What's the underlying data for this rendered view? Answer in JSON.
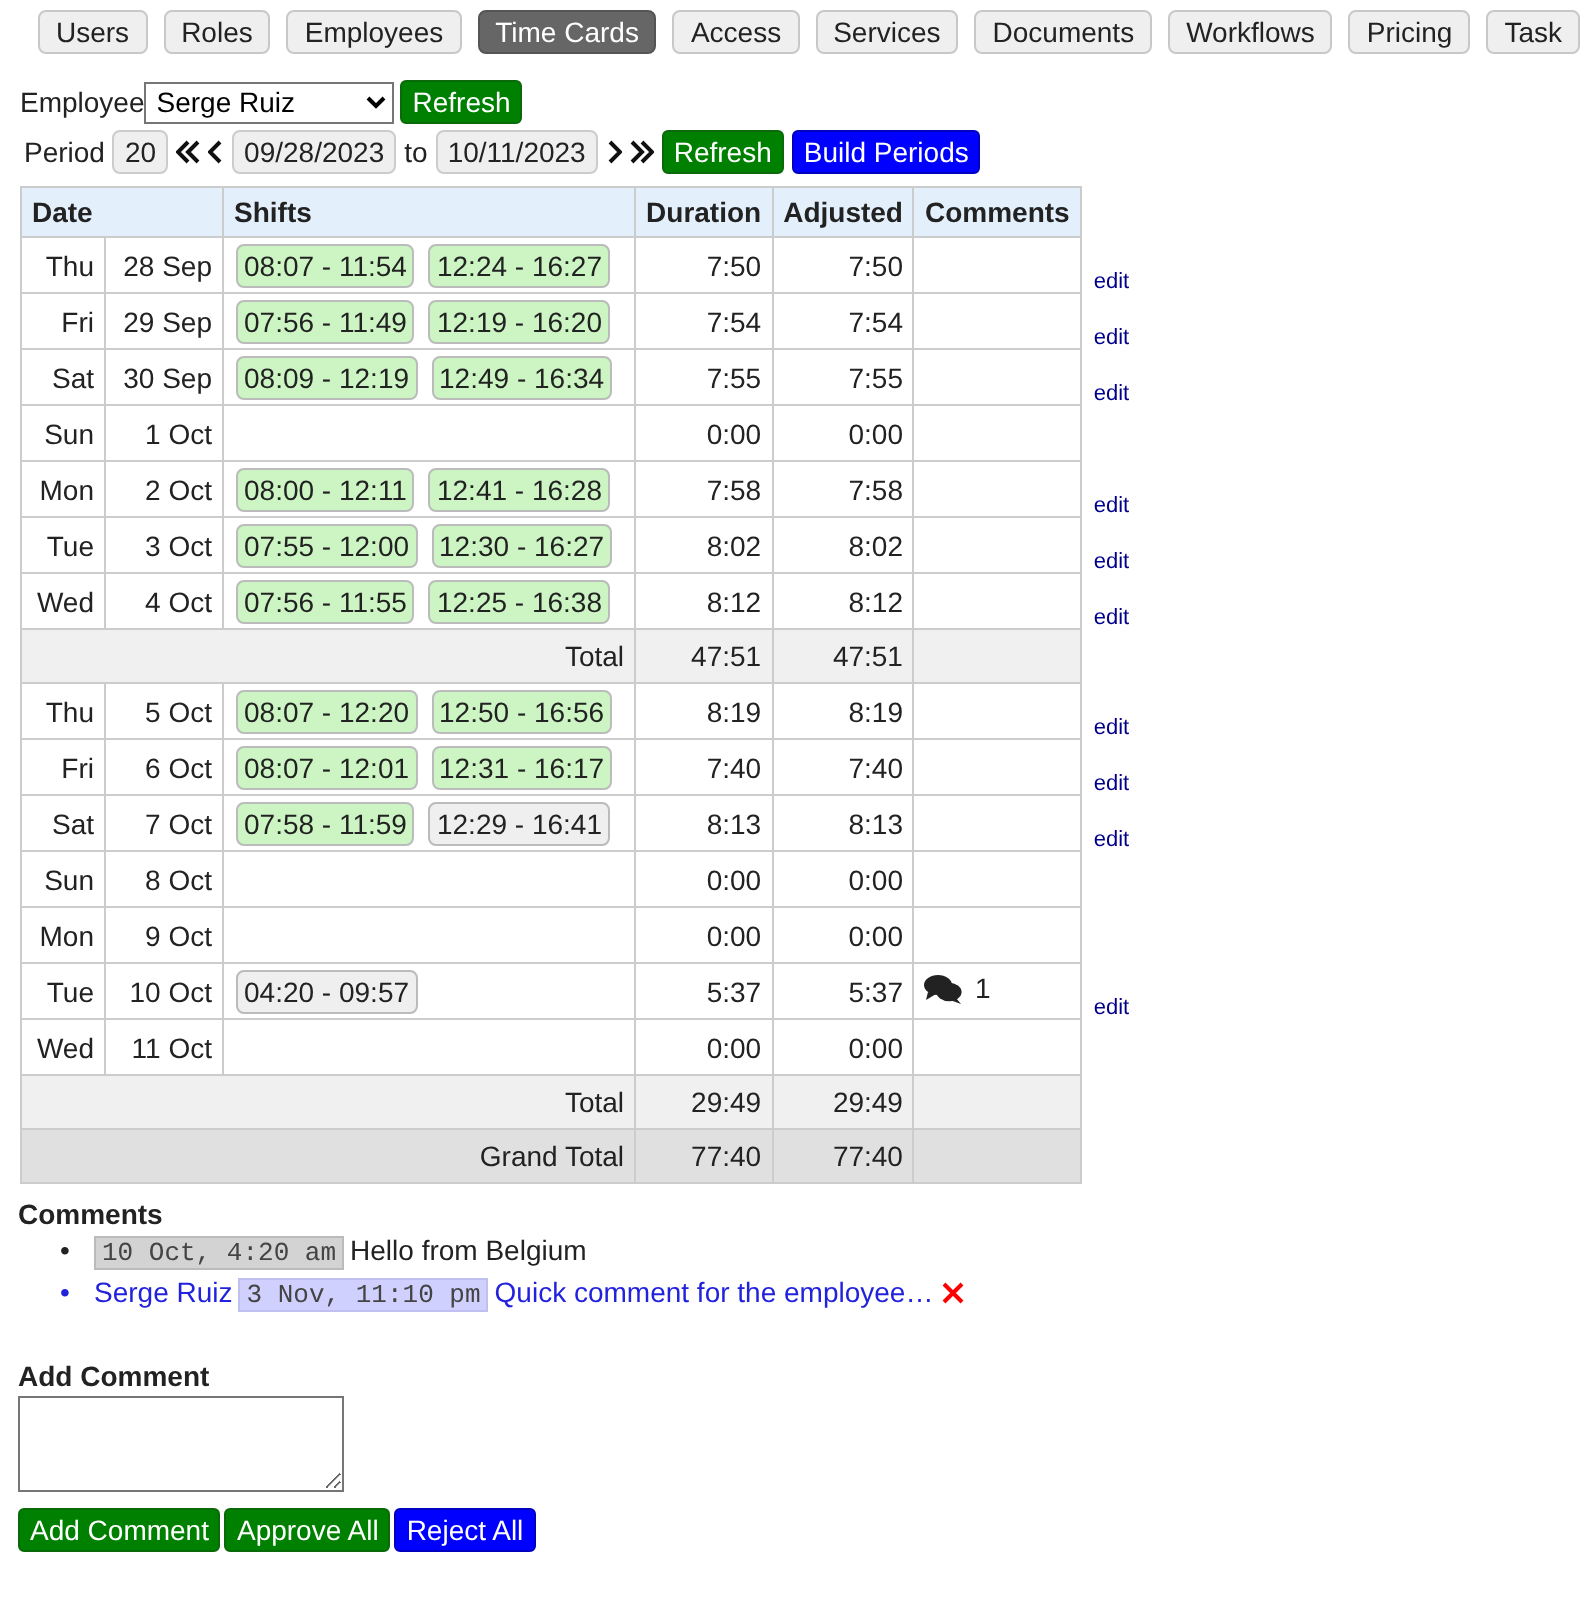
{
  "nav": [
    {
      "label": "Users",
      "selected": false
    },
    {
      "label": "Roles",
      "selected": false
    },
    {
      "label": "Employees",
      "selected": false
    },
    {
      "label": "Time Cards",
      "selected": true
    },
    {
      "label": "Access",
      "selected": false
    },
    {
      "label": "Services",
      "selected": false
    },
    {
      "label": "Documents",
      "selected": false
    },
    {
      "label": "Workflows",
      "selected": false
    },
    {
      "label": "Pricing",
      "selected": false
    },
    {
      "label": "Task",
      "selected": false
    }
  ],
  "employee": {
    "label": "Employee",
    "value": "Serge Ruiz",
    "refresh": "Refresh"
  },
  "period": {
    "label": "Period",
    "number": "20",
    "from": "09/28/2023",
    "to_label": "to",
    "to": "10/11/2023",
    "refresh": "Refresh",
    "build": "Build Periods"
  },
  "table": {
    "columns": [
      "Date",
      "Shifts",
      "Duration",
      "Adjusted",
      "Comments"
    ],
    "weeks": [
      {
        "days": [
          {
            "day": "Thu",
            "date": "28 Sep",
            "shifts": [
              {
                "time": "08:07 - 11:54",
                "approved": true
              },
              {
                "time": "12:24 - 16:27",
                "approved": true
              }
            ],
            "duration": "7:50",
            "adjusted": "7:50",
            "action": "edit"
          },
          {
            "day": "Fri",
            "date": "29 Sep",
            "shifts": [
              {
                "time": "07:56 - 11:49",
                "approved": true
              },
              {
                "time": "12:19 - 16:20",
                "approved": true
              }
            ],
            "duration": "7:54",
            "adjusted": "7:54",
            "action": "edit"
          },
          {
            "day": "Sat",
            "date": "30 Sep",
            "shifts": [
              {
                "time": "08:09 - 12:19",
                "approved": true
              },
              {
                "time": "12:49 - 16:34",
                "approved": true
              }
            ],
            "duration": "7:55",
            "adjusted": "7:55",
            "action": "edit"
          },
          {
            "day": "Sun",
            "date": "1 Oct",
            "duration": "0:00",
            "adjusted": "0:00"
          },
          {
            "day": "Mon",
            "date": "2 Oct",
            "shifts": [
              {
                "time": "08:00 - 12:11",
                "approved": true
              },
              {
                "time": "12:41 - 16:28",
                "approved": true
              }
            ],
            "duration": "7:58",
            "adjusted": "7:58",
            "action": "edit"
          },
          {
            "day": "Tue",
            "date": "3 Oct",
            "shifts": [
              {
                "time": "07:55 - 12:00",
                "approved": true
              },
              {
                "time": "12:30 - 16:27",
                "approved": true
              }
            ],
            "duration": "8:02",
            "adjusted": "8:02",
            "action": "edit"
          },
          {
            "day": "Wed",
            "date": "4 Oct",
            "shifts": [
              {
                "time": "07:56 - 11:55",
                "approved": true
              },
              {
                "time": "12:25 - 16:38",
                "approved": true
              }
            ],
            "duration": "8:12",
            "adjusted": "8:12",
            "action": "edit"
          }
        ],
        "total": {
          "label": "Total",
          "duration": "47:51",
          "adjusted": "47:51"
        }
      },
      {
        "days": [
          {
            "day": "Thu",
            "date": "5 Oct",
            "shifts": [
              {
                "time": "08:07 - 12:20",
                "approved": true
              },
              {
                "time": "12:50 - 16:56",
                "approved": true
              }
            ],
            "duration": "8:19",
            "adjusted": "8:19",
            "action": "edit"
          },
          {
            "day": "Fri",
            "date": "6 Oct",
            "shifts": [
              {
                "time": "08:07 - 12:01",
                "approved": true
              },
              {
                "time": "12:31 - 16:17",
                "approved": true
              }
            ],
            "duration": "7:40",
            "adjusted": "7:40",
            "action": "edit"
          },
          {
            "day": "Sat",
            "date": "7 Oct",
            "shifts": [
              {
                "time": "07:58 - 11:59",
                "approved": true
              },
              {
                "time": "12:29 - 16:41",
                "approved": false
              }
            ],
            "duration": "8:13",
            "adjusted": "8:13",
            "action": "edit"
          },
          {
            "day": "Sun",
            "date": "8 Oct",
            "duration": "0:00",
            "adjusted": "0:00"
          },
          {
            "day": "Mon",
            "date": "9 Oct",
            "duration": "0:00",
            "adjusted": "0:00"
          },
          {
            "day": "Tue",
            "date": "10 Oct",
            "shifts": [
              {
                "time": "04:20 - 09:57",
                "approved": false
              }
            ],
            "duration": "5:37",
            "adjusted": "5:37",
            "comments": "1",
            "action": "edit"
          },
          {
            "day": "Wed",
            "date": "11 Oct",
            "duration": "0:00",
            "adjusted": "0:00"
          }
        ],
        "total": {
          "label": "Total",
          "duration": "29:49",
          "adjusted": "29:49"
        }
      }
    ],
    "grand_total": {
      "label": "Grand Total",
      "duration": "77:40",
      "adjusted": "77:40"
    }
  },
  "comments": {
    "title": "Comments",
    "items": [
      {
        "kind": "other",
        "marker": "•",
        "time": "10 Oct, 4:20 am",
        "text": "Hello from Belgium"
      },
      {
        "kind": "own",
        "marker": "•",
        "author": "Serge Ruiz",
        "time": "3 Nov, 11:10 pm",
        "text": "Quick comment for the employee…"
      }
    ]
  },
  "add_comment": {
    "title": "Add Comment",
    "buttons": [
      {
        "label": "Add Comment",
        "kind": "green"
      },
      {
        "label": "Approve All",
        "kind": "green"
      },
      {
        "label": "Reject All",
        "kind": "blue"
      }
    ]
  }
}
